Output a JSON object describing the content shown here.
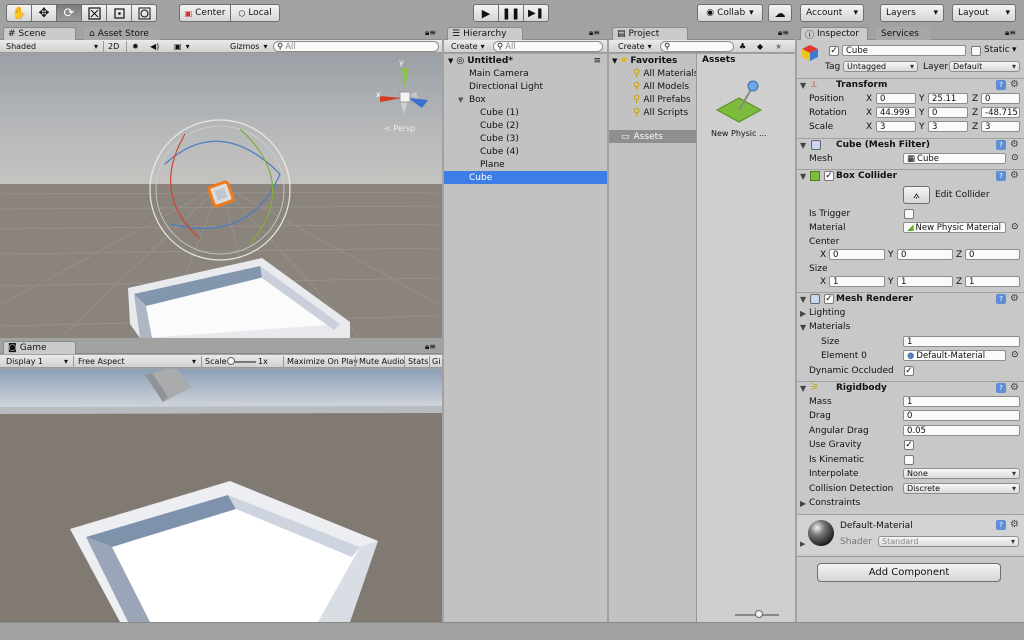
{
  "toolbar": {
    "pivot_mode": "Center",
    "pivot_rotation": "Local",
    "collab": "Collab",
    "account": "Account",
    "layers": "Layers",
    "layout": "Layout"
  },
  "scene": {
    "tab_scene": "Scene",
    "tab_asset_store": "Asset Store",
    "shading_mode": "Shaded",
    "mode_2d": "2D",
    "gizmos": "Gizmos",
    "search_placeholder": "All",
    "persp_label": "Persp",
    "axis_y": "y",
    "axis_x": "x"
  },
  "game": {
    "tab_game": "Game",
    "display": "Display 1",
    "aspect": "Free Aspect",
    "scale_label": "Scale",
    "scale_value": "1x",
    "maximize_on_play": "Maximize On Play",
    "mute_audio": "Mute Audio",
    "stats": "Stats",
    "gizmos": "Gi"
  },
  "hierarchy": {
    "tab": "Hierarchy",
    "create": "Create",
    "search_placeholder": "All",
    "scene_name": "Untitled*",
    "items": [
      {
        "label": "Main Camera",
        "depth": 1
      },
      {
        "label": "Directional Light",
        "depth": 1
      },
      {
        "label": "Box",
        "depth": 1
      },
      {
        "label": "Cube (1)",
        "depth": 2
      },
      {
        "label": "Cube (2)",
        "depth": 2
      },
      {
        "label": "Cube (3)",
        "depth": 2
      },
      {
        "label": "Cube (4)",
        "depth": 2
      },
      {
        "label": "Plane",
        "depth": 2
      },
      {
        "label": "Cube",
        "depth": 1
      }
    ],
    "selected_label": "Cube"
  },
  "project": {
    "tab": "Project",
    "create": "Create",
    "favorites": "Favorites",
    "favorite_items": [
      "All Materials",
      "All Models",
      "All Prefabs",
      "All Scripts"
    ],
    "assets_folder": "Assets",
    "assets_header": "Assets",
    "asset_item": "New Physic ..."
  },
  "inspector": {
    "tab_inspector": "Inspector",
    "tab_services": "Services",
    "object_name": "Cube",
    "static_label": "Static",
    "tag_label": "Tag",
    "tag_value": "Untagged",
    "layer_label": "Layer",
    "layer_value": "Default",
    "transform": {
      "title": "Transform",
      "position_label": "Position",
      "rotation_label": "Rotation",
      "scale_label": "Scale",
      "axis_x": "X",
      "axis_y": "Y",
      "axis_z": "Z",
      "position": [
        "0",
        "25.11",
        "0"
      ],
      "rotation": [
        "44.999",
        "0",
        "-48.715"
      ],
      "scale": [
        "3",
        "3",
        "3"
      ]
    },
    "mesh_filter": {
      "title": "Cube (Mesh Filter)",
      "mesh_label": "Mesh",
      "mesh_value": "Cube"
    },
    "box_collider": {
      "title": "Box Collider",
      "edit_collider": "Edit Collider",
      "is_trigger_label": "Is Trigger",
      "material_label": "Material",
      "material_value": "New Physic Material",
      "center_label": "Center",
      "center": [
        "0",
        "0",
        "0"
      ],
      "size_label": "Size",
      "size": [
        "1",
        "1",
        "1"
      ]
    },
    "mesh_renderer": {
      "title": "Mesh Renderer",
      "lighting_label": "Lighting",
      "materials_label": "Materials",
      "size_label": "Size",
      "size_value": "1",
      "element0_label": "Element 0",
      "element0_value": "Default-Material",
      "dynamic_occluded_label": "Dynamic Occluded"
    },
    "rigidbody": {
      "title": "Rigidbody",
      "mass_label": "Mass",
      "mass": "1",
      "drag_label": "Drag",
      "drag": "0",
      "angular_drag_label": "Angular Drag",
      "angular_drag": "0.05",
      "use_gravity_label": "Use Gravity",
      "is_kinematic_label": "Is Kinematic",
      "interpolate_label": "Interpolate",
      "interpolate": "None",
      "collision_detection_label": "Collision Detection",
      "collision_detection": "Discrete",
      "constraints_label": "Constraints"
    },
    "material": {
      "name": "Default-Material",
      "shader_label": "Shader",
      "shader_value": "Standard"
    },
    "add_component": "Add Component"
  },
  "colors": {
    "selection": "#3e7de7",
    "panel_bg": "#c2c2c2",
    "toolbar_bg": "#a2a2a2"
  }
}
